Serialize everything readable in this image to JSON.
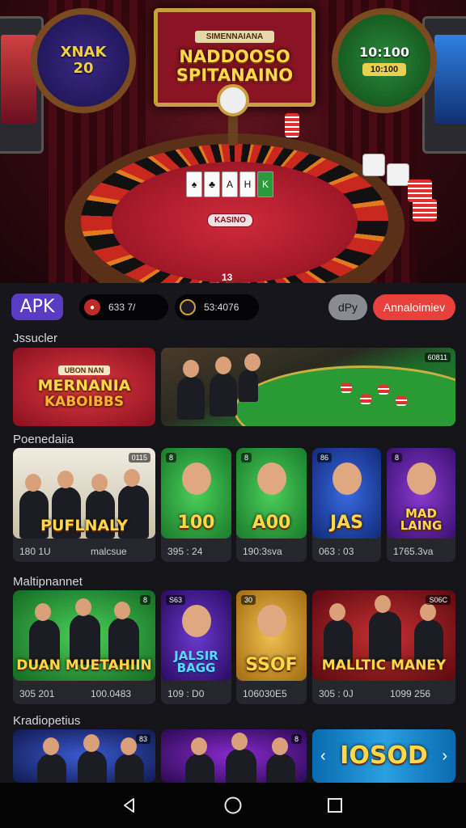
{
  "hero": {
    "banner_top": "SIMENNAIANA",
    "banner_title_line1": "NADDOOSO",
    "banner_title_line2": "SPITANAINO",
    "left_wheel_line1": "XNAK",
    "left_wheel_line2": "20",
    "right_wheel_value": "10:100",
    "right_wheel_box": "10:100",
    "table_label": "KASINO",
    "table_number": "13",
    "cards": [
      "♠",
      "♣",
      "A",
      "H",
      "K"
    ]
  },
  "topbar": {
    "apk_label": "APK",
    "balance_1": "633 7/",
    "balance_2": "53:4076",
    "pill_1": "dPy",
    "pill_2": "Annaloimiev"
  },
  "sections": [
    {
      "title": "Jssucler",
      "tiles": [
        {
          "title_line1": "MERNANIA",
          "title_line2": "KABOIBBS",
          "top_label": "UBON NAN"
        },
        {
          "badge": "60811"
        }
      ]
    },
    {
      "title": "Poenedaiia",
      "cards": [
        {
          "name": "PUFLNALY",
          "badge": "0115",
          "stat_left": "180 1U",
          "stat_right": "malcsue"
        },
        {
          "name": "100",
          "badge": "8",
          "stat": "395 : 24"
        },
        {
          "name": "A00",
          "badge": "8",
          "stat": "190:3sva"
        },
        {
          "name": "JAS",
          "badge": "86",
          "stat": "063 : 03"
        },
        {
          "name": "MAD LAING",
          "badge": "8",
          "stat": "1765.3va"
        }
      ]
    },
    {
      "title": "Maltipnannet",
      "cards": [
        {
          "name": "DUAN MUETAHIIN",
          "badge": "8",
          "stat_left": "305 201",
          "stat_right": "100.0483"
        },
        {
          "name": "JALSIR BAGG",
          "badge": "S63",
          "stat_left": "109 : D0"
        },
        {
          "name": "SSOF",
          "badge": "30",
          "stat_right": "106030E5"
        },
        {
          "name": "MALLTIC MANEY",
          "badge": "S06C",
          "stat_left": "305 : 0J",
          "stat_right": "1099 256"
        }
      ]
    },
    {
      "title": "Kradiopetius",
      "cards": [
        {
          "badge": "83"
        },
        {
          "badge": "8"
        },
        {
          "name": "IOSOD"
        }
      ]
    }
  ],
  "nav": {
    "back": "back-icon",
    "home": "home-icon",
    "recents": "recents-icon"
  }
}
